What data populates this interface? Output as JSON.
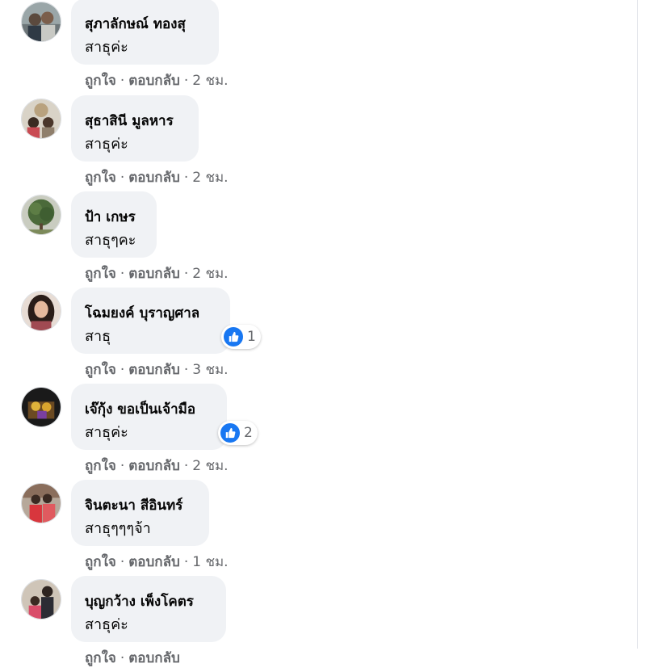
{
  "comments": [
    {
      "author": "สุภาลักษณ์ ทองสุ",
      "text": "สาธุค่ะ",
      "like": "ถูกใจ",
      "reply": "ตอบกลับ",
      "time": "2 ชม.",
      "reactions": null
    },
    {
      "author": "สุธาสินี มูลหาร",
      "text": "สาธุค่ะ",
      "like": "ถูกใจ",
      "reply": "ตอบกลับ",
      "time": "2 ชม.",
      "reactions": null
    },
    {
      "author": "ป้า เกษร",
      "text": "สาธุๆคะ",
      "like": "ถูกใจ",
      "reply": "ตอบกลับ",
      "time": "2 ชม.",
      "reactions": null
    },
    {
      "author": "โฉมยงค์ บุราญศาล",
      "text": "สาธุ",
      "like": "ถูกใจ",
      "reply": "ตอบกลับ",
      "time": "3 ชม.",
      "reactions": {
        "icon": "like-icon",
        "count": "1"
      }
    },
    {
      "author": "เจ๊กุ้ง ขอเป็นเจ้ามือ",
      "text": "สาธุค่ะ",
      "like": "ถูกใจ",
      "reply": "ตอบกลับ",
      "time": "2 ชม.",
      "reactions": {
        "icon": "like-icon",
        "count": "2"
      }
    },
    {
      "author": "จินตะนา สีอินทร์",
      "text": "สาธุๆๆๆจ้า",
      "like": "ถูกใจ",
      "reply": "ตอบกลับ",
      "time": "1 ชม.",
      "reactions": null
    },
    {
      "author": "บุญกว้าง เพ็งโคตร",
      "text": "สาธุค่ะ",
      "like": "ถูกใจ",
      "reply": "ตอบกลับ",
      "time": "",
      "reactions": null
    }
  ],
  "separator": "·",
  "colors": {
    "bubble": "#f0f2f5",
    "meta": "#65676b",
    "like_blue": "#1877f2",
    "text": "#050505"
  }
}
